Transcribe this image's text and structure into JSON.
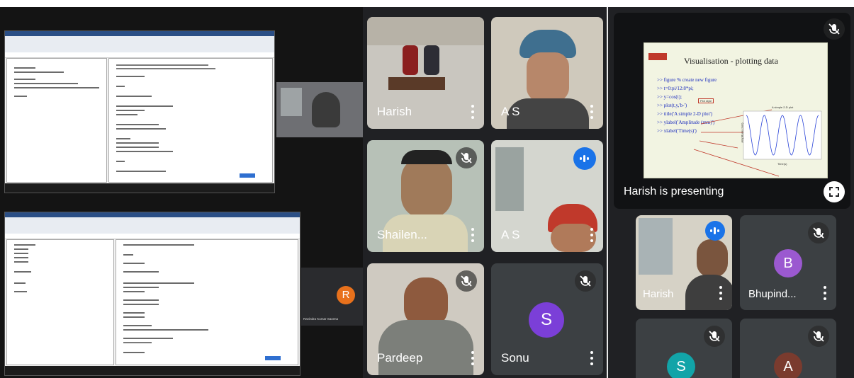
{
  "collage": {
    "participant_caption": "Ravindra Kumar Saxena",
    "participant_initial": "R",
    "avatar_color": "#e8711c"
  },
  "tiles": [
    {
      "name": "Harish",
      "muted": false
    },
    {
      "name": "A S",
      "muted": false
    },
    {
      "name": "Shailen...",
      "muted": true
    },
    {
      "name": "A S",
      "muted": false,
      "speaking": true
    },
    {
      "name": "Pardeep",
      "muted": true
    },
    {
      "name": "Sonu",
      "muted": true,
      "initial": "S",
      "avatar_color": "#7b3fd8"
    }
  ],
  "presentation": {
    "label": "Harish is presenting",
    "slide": {
      "title": "Visualisation - plotting data",
      "lines": [
        ">> figure  % create new figure",
        ">> t=0:pi/12:8*pi;",
        ">> y=cos(t);",
        ">> plot(t,y,'b-')",
        ">> title('A simple 2-D plot')",
        ">> ylabel('Amplitude (mm)')",
        ">> xlabel('Time(s)')"
      ],
      "callout": "Plot style",
      "plot_title": "A simple 2-D plot",
      "plot_ylabel": "Amplitude (mm)",
      "plot_xlabel": "Time(s)"
    }
  },
  "side_tiles": [
    {
      "name": "Harish",
      "speaking": true
    },
    {
      "name": "Bhupind...",
      "muted": true,
      "initial": "B",
      "avatar_color": "#9b59d0"
    },
    {
      "name": "",
      "muted": true,
      "initial": "S",
      "avatar_color": "#12a4a8"
    },
    {
      "name": "",
      "muted": true,
      "initial": "A",
      "avatar_color": "#7a3b2e"
    }
  ],
  "colors": {
    "meet_dark": "#202124",
    "tile_bg": "#3c4043",
    "accent_blue": "#1a73e8"
  }
}
